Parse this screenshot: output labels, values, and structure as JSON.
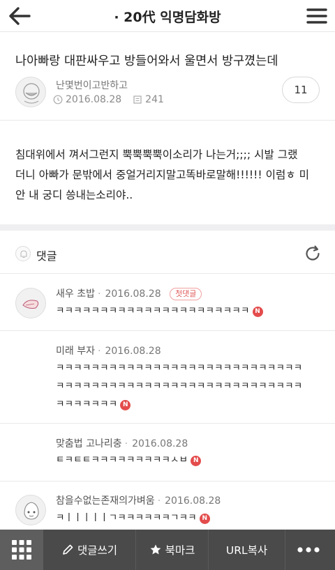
{
  "header": {
    "board_title": "· 20代 익명담화방"
  },
  "post": {
    "title": "나아빠랑 대판싸우고 방들어와서 울면서 방구꼈는데",
    "author": "난몇번이고반하고",
    "date": "2016.08.28",
    "views": "241",
    "comment_count": "11",
    "body_lines": [
      "침대위에서 껴서그런지 뿍뿍뿍뿍이소리가 나는거;;;; 시발 그랬",
      "더니 아빠가 문밖에서 중얼거리지말고똑바로말해!!!!!! 이럼ㅎ 미",
      "안 내 궁디 씅내는소리야.."
    ]
  },
  "comments_section": {
    "label": "댓글"
  },
  "comments": [
    {
      "name": "새우 초밥",
      "date": "2016.08.28",
      "badge": "첫댓글",
      "lines": [
        "ㅋㅋㅋㅋㅋㅋㅋㅋㅋㅋㅋㅋㅋㅋㅋㅋㅋㅋㅋㅋㅋㅋ"
      ]
    },
    {
      "name": "미래 부자",
      "date": "2016.08.28",
      "lines": [
        "ㅋㅋㅋㅋㅋㅋㅋㅋㅋㅋㅋㅋㅋㅋㅋㅋㅋㅋㅋㅋㅋㅋㅋㅋㅋㅋㅋㅋ",
        "ㅋㅋㅋㅋㅋㅋㅋㅋㅋㅋㅋㅋㅋㅋㅋㅋㅋㅋㅋㅋㅋㅋㅋㅋㅋㅋㅋㅋ",
        "ㅋㅋㅋㅋㅋㅋㅋ"
      ]
    },
    {
      "name": "맞춤법 고나리충",
      "date": "2016.08.28",
      "lines": [
        "ㅌㅋㅌㅌㅋㅋㅋㅋㅋㅋㅋㅋㅋㅅㅂ"
      ]
    },
    {
      "name": "참을수없는존재의가벼움",
      "date": "2016.08.28",
      "lines": [
        "ㅋㅣㅣㅣㅣㅣㄱㅋㅋㅋㅋㅋㅋㄱㅋㅋ"
      ]
    }
  ],
  "new_badge": "N",
  "toolbar": {
    "write": "댓글쓰기",
    "bookmark": "북마크",
    "copy_url": "URL복사"
  },
  "icons": [
    "back-arrow-icon",
    "hamburger-menu-icon",
    "clock-icon",
    "views-icon",
    "bell-icon",
    "refresh-icon",
    "grid-icon",
    "pencil-icon",
    "star-icon",
    "more-icon"
  ],
  "colors": {
    "toolbar": "#4a4a4a",
    "new_badge": "#e44c4c",
    "first_badge": "#e05a5a"
  }
}
